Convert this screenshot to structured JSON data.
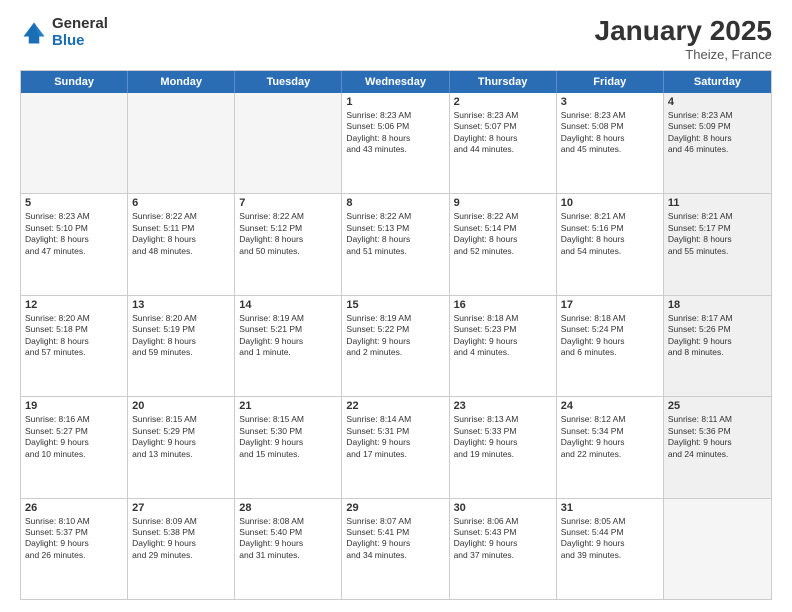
{
  "logo": {
    "general": "General",
    "blue": "Blue"
  },
  "title": "January 2025",
  "subtitle": "Theize, France",
  "header_days": [
    "Sunday",
    "Monday",
    "Tuesday",
    "Wednesday",
    "Thursday",
    "Friday",
    "Saturday"
  ],
  "rows": [
    [
      {
        "day": "",
        "info": "",
        "empty": true
      },
      {
        "day": "",
        "info": "",
        "empty": true
      },
      {
        "day": "",
        "info": "",
        "empty": true
      },
      {
        "day": "1",
        "info": "Sunrise: 8:23 AM\nSunset: 5:06 PM\nDaylight: 8 hours\nand 43 minutes.",
        "empty": false
      },
      {
        "day": "2",
        "info": "Sunrise: 8:23 AM\nSunset: 5:07 PM\nDaylight: 8 hours\nand 44 minutes.",
        "empty": false
      },
      {
        "day": "3",
        "info": "Sunrise: 8:23 AM\nSunset: 5:08 PM\nDaylight: 8 hours\nand 45 minutes.",
        "empty": false
      },
      {
        "day": "4",
        "info": "Sunrise: 8:23 AM\nSunset: 5:09 PM\nDaylight: 8 hours\nand 46 minutes.",
        "empty": false,
        "shaded": true
      }
    ],
    [
      {
        "day": "5",
        "info": "Sunrise: 8:23 AM\nSunset: 5:10 PM\nDaylight: 8 hours\nand 47 minutes.",
        "empty": false
      },
      {
        "day": "6",
        "info": "Sunrise: 8:22 AM\nSunset: 5:11 PM\nDaylight: 8 hours\nand 48 minutes.",
        "empty": false
      },
      {
        "day": "7",
        "info": "Sunrise: 8:22 AM\nSunset: 5:12 PM\nDaylight: 8 hours\nand 50 minutes.",
        "empty": false
      },
      {
        "day": "8",
        "info": "Sunrise: 8:22 AM\nSunset: 5:13 PM\nDaylight: 8 hours\nand 51 minutes.",
        "empty": false
      },
      {
        "day": "9",
        "info": "Sunrise: 8:22 AM\nSunset: 5:14 PM\nDaylight: 8 hours\nand 52 minutes.",
        "empty": false
      },
      {
        "day": "10",
        "info": "Sunrise: 8:21 AM\nSunset: 5:16 PM\nDaylight: 8 hours\nand 54 minutes.",
        "empty": false
      },
      {
        "day": "11",
        "info": "Sunrise: 8:21 AM\nSunset: 5:17 PM\nDaylight: 8 hours\nand 55 minutes.",
        "empty": false,
        "shaded": true
      }
    ],
    [
      {
        "day": "12",
        "info": "Sunrise: 8:20 AM\nSunset: 5:18 PM\nDaylight: 8 hours\nand 57 minutes.",
        "empty": false
      },
      {
        "day": "13",
        "info": "Sunrise: 8:20 AM\nSunset: 5:19 PM\nDaylight: 8 hours\nand 59 minutes.",
        "empty": false
      },
      {
        "day": "14",
        "info": "Sunrise: 8:19 AM\nSunset: 5:21 PM\nDaylight: 9 hours\nand 1 minute.",
        "empty": false
      },
      {
        "day": "15",
        "info": "Sunrise: 8:19 AM\nSunset: 5:22 PM\nDaylight: 9 hours\nand 2 minutes.",
        "empty": false
      },
      {
        "day": "16",
        "info": "Sunrise: 8:18 AM\nSunset: 5:23 PM\nDaylight: 9 hours\nand 4 minutes.",
        "empty": false
      },
      {
        "day": "17",
        "info": "Sunrise: 8:18 AM\nSunset: 5:24 PM\nDaylight: 9 hours\nand 6 minutes.",
        "empty": false
      },
      {
        "day": "18",
        "info": "Sunrise: 8:17 AM\nSunset: 5:26 PM\nDaylight: 9 hours\nand 8 minutes.",
        "empty": false,
        "shaded": true
      }
    ],
    [
      {
        "day": "19",
        "info": "Sunrise: 8:16 AM\nSunset: 5:27 PM\nDaylight: 9 hours\nand 10 minutes.",
        "empty": false
      },
      {
        "day": "20",
        "info": "Sunrise: 8:15 AM\nSunset: 5:29 PM\nDaylight: 9 hours\nand 13 minutes.",
        "empty": false
      },
      {
        "day": "21",
        "info": "Sunrise: 8:15 AM\nSunset: 5:30 PM\nDaylight: 9 hours\nand 15 minutes.",
        "empty": false
      },
      {
        "day": "22",
        "info": "Sunrise: 8:14 AM\nSunset: 5:31 PM\nDaylight: 9 hours\nand 17 minutes.",
        "empty": false
      },
      {
        "day": "23",
        "info": "Sunrise: 8:13 AM\nSunset: 5:33 PM\nDaylight: 9 hours\nand 19 minutes.",
        "empty": false
      },
      {
        "day": "24",
        "info": "Sunrise: 8:12 AM\nSunset: 5:34 PM\nDaylight: 9 hours\nand 22 minutes.",
        "empty": false
      },
      {
        "day": "25",
        "info": "Sunrise: 8:11 AM\nSunset: 5:36 PM\nDaylight: 9 hours\nand 24 minutes.",
        "empty": false,
        "shaded": true
      }
    ],
    [
      {
        "day": "26",
        "info": "Sunrise: 8:10 AM\nSunset: 5:37 PM\nDaylight: 9 hours\nand 26 minutes.",
        "empty": false
      },
      {
        "day": "27",
        "info": "Sunrise: 8:09 AM\nSunset: 5:38 PM\nDaylight: 9 hours\nand 29 minutes.",
        "empty": false
      },
      {
        "day": "28",
        "info": "Sunrise: 8:08 AM\nSunset: 5:40 PM\nDaylight: 9 hours\nand 31 minutes.",
        "empty": false
      },
      {
        "day": "29",
        "info": "Sunrise: 8:07 AM\nSunset: 5:41 PM\nDaylight: 9 hours\nand 34 minutes.",
        "empty": false
      },
      {
        "day": "30",
        "info": "Sunrise: 8:06 AM\nSunset: 5:43 PM\nDaylight: 9 hours\nand 37 minutes.",
        "empty": false
      },
      {
        "day": "31",
        "info": "Sunrise: 8:05 AM\nSunset: 5:44 PM\nDaylight: 9 hours\nand 39 minutes.",
        "empty": false
      },
      {
        "day": "",
        "info": "",
        "empty": true,
        "shaded": true
      }
    ]
  ]
}
